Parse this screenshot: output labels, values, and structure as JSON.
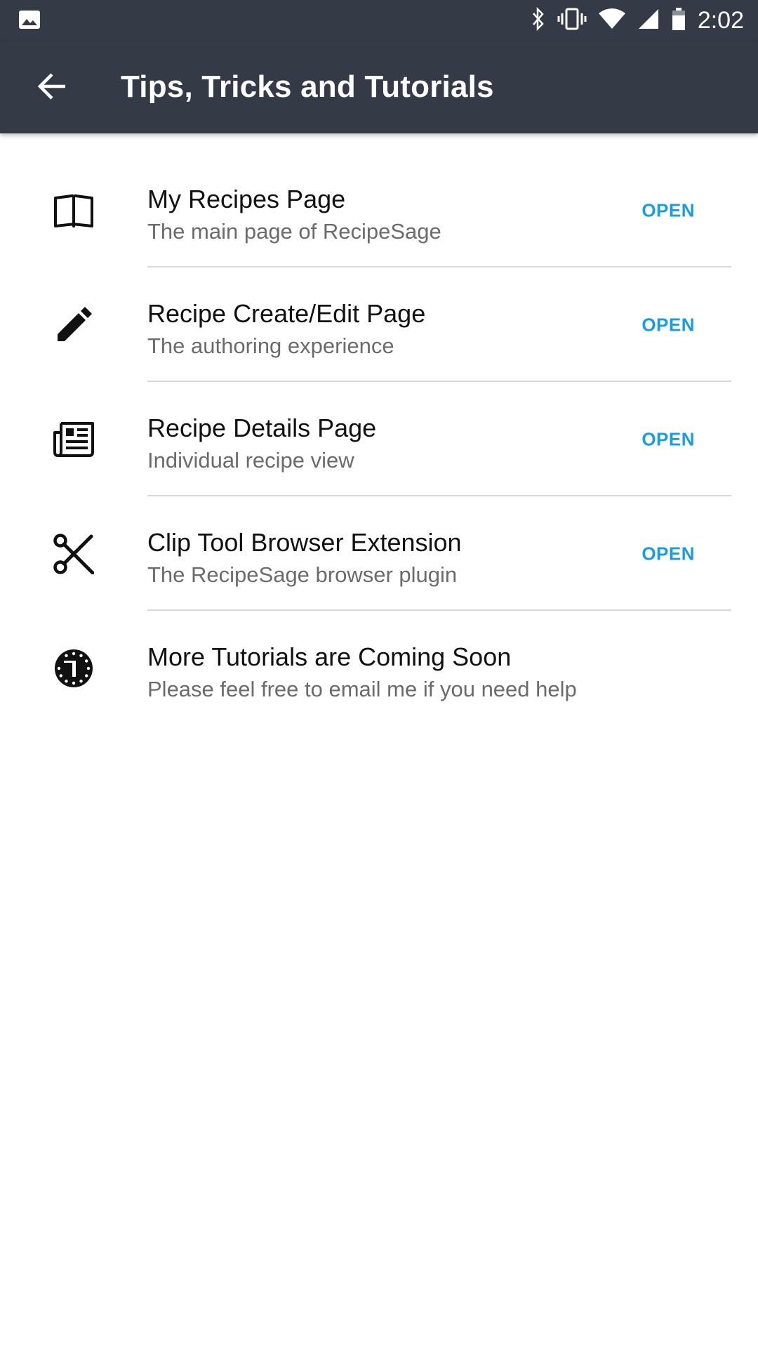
{
  "status_bar": {
    "time": "2:02",
    "icons": [
      "image-icon",
      "bluetooth-icon",
      "vibrate-icon",
      "wifi-icon",
      "signal-icon",
      "battery-icon"
    ]
  },
  "app_bar": {
    "title": "Tips, Tricks and Tutorials",
    "back_icon": "arrow-back-icon"
  },
  "accent_color": "#1a9ce0",
  "header_color": "#353a47",
  "items": [
    {
      "icon": "book-icon",
      "title": "My Recipes Page",
      "subtitle": "The main page of RecipeSage",
      "action": "OPEN"
    },
    {
      "icon": "pencil-icon",
      "title": "Recipe Create/Edit Page",
      "subtitle": "The authoring experience",
      "action": "OPEN"
    },
    {
      "icon": "newspaper-icon",
      "title": "Recipe Details Page",
      "subtitle": "Individual recipe view",
      "action": "OPEN"
    },
    {
      "icon": "scissors-icon",
      "title": "Clip Tool Browser Extension",
      "subtitle": "The RecipeSage browser plugin",
      "action": "OPEN"
    },
    {
      "icon": "clock-icon",
      "title": "More Tutorials are Coming Soon",
      "subtitle": "Please feel free to email me if you need help"
    }
  ]
}
